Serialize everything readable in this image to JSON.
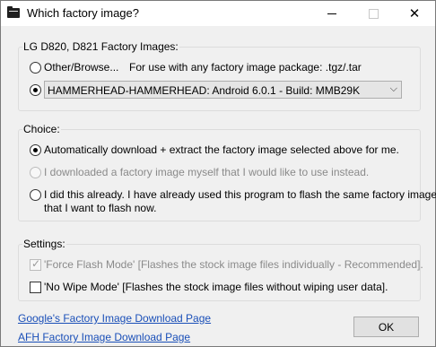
{
  "window": {
    "title": "Which factory image?",
    "icon": "folder-icon",
    "controls": {
      "minimize": "minimize-icon",
      "maximize": "maximize-icon",
      "close": "✕"
    }
  },
  "factory_images": {
    "legend": "LG D820, D821 Factory Images:",
    "other_browse_label": "Other/Browse...",
    "other_browse_hint": "For use with any factory image package: .tgz/.tar",
    "selected_image": "HAMMERHEAD-HAMMERHEAD: Android 6.0.1 - Build: MMB29K",
    "dropdown_arrow": "⌵"
  },
  "choice": {
    "legend": "Choice:",
    "options": [
      {
        "label": "Automatically download + extract the factory image selected above for me.",
        "checked": true,
        "enabled": true
      },
      {
        "label": "I downloaded a factory image myself that I would like to use instead.",
        "checked": false,
        "enabled": false
      },
      {
        "label_line1": "I did this already. I have already used this program to flash the same factory image",
        "label_line2": "that I want to flash now.",
        "checked": false,
        "enabled": true
      }
    ]
  },
  "settings": {
    "legend": "Settings:",
    "force_flash": {
      "label": "'Force Flash Mode' [Flashes the stock image files individually - Recommended].",
      "checked": true,
      "enabled": false,
      "check_glyph": "✓"
    },
    "no_wipe": {
      "label": "'No Wipe Mode' [Flashes the stock image files without wiping user data].",
      "checked": false,
      "enabled": true
    }
  },
  "links": {
    "google": "Google's Factory Image Download Page",
    "afh": "AFH Factory Image Download Page"
  },
  "buttons": {
    "ok": "OK"
  }
}
